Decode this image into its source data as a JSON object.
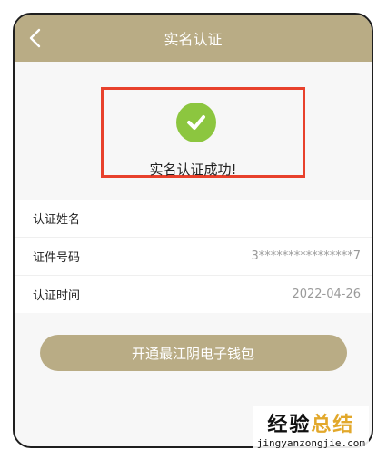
{
  "header": {
    "title": "实名认证",
    "back_icon": "chevron-left-icon"
  },
  "success": {
    "icon": "check-circle-icon",
    "message": "实名认证成功!",
    "accent": "#8cc63f",
    "highlight_color": "#e8412c"
  },
  "info_rows": [
    {
      "label": "认证姓名",
      "value": ""
    },
    {
      "label": "证件号码",
      "value": "3****************7"
    },
    {
      "label": "认证时间",
      "value": "2022-04-26"
    }
  ],
  "action": {
    "label": "开通最江阴电子钱包"
  },
  "watermark": {
    "text_black": "经验",
    "text_gold": "总结",
    "url": "jingyanzongjie.com"
  },
  "colors": {
    "brand": "#b9ac85",
    "background": "#f7f7f7"
  }
}
